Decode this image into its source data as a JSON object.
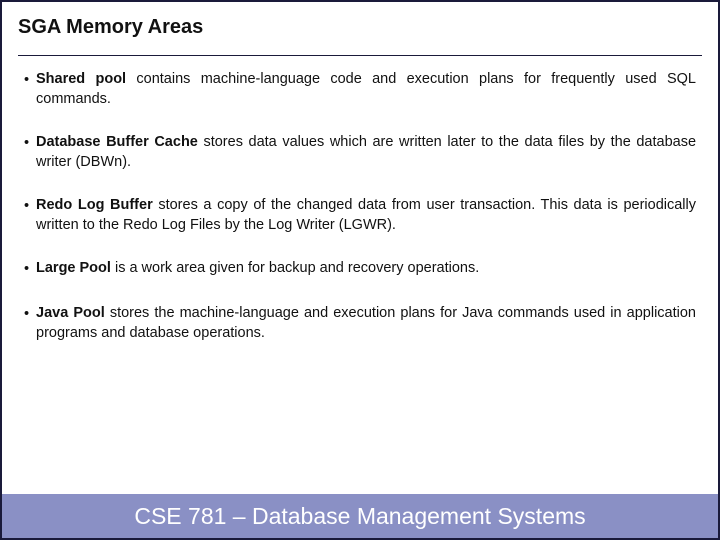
{
  "title": "SGA Memory Areas",
  "bullets": [
    {
      "term": "Shared pool",
      "rest": " contains machine-language code and execution plans for frequently used SQL commands."
    },
    {
      "term": "Database Buffer Cache",
      "rest": " stores data values which are written later to the data files by the database writer (DBWn)."
    },
    {
      "term": "Redo Log Buffer",
      "rest": " stores a copy of the changed data from user transaction. This data is periodically written to the Redo Log Files by the Log Writer (LGWR)."
    },
    {
      "term": "Large Pool",
      "rest": " is a work area given for backup and recovery operations."
    },
    {
      "term": "Java Pool",
      "rest": " stores the machine-language and execution plans for Java commands used in application programs and database operations."
    }
  ],
  "footer": "CSE 781 – Database Management Systems"
}
